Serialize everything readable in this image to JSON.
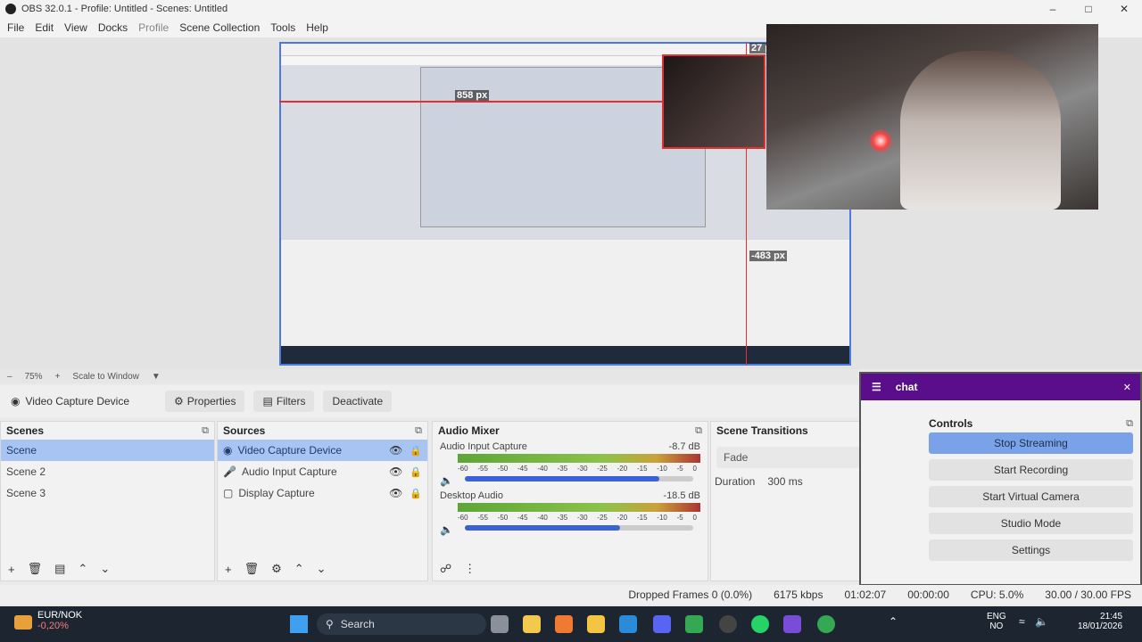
{
  "window": {
    "title": "OBS 32.0.1 - Profile: Untitled - Scenes: Untitled"
  },
  "menu": [
    "File",
    "Edit",
    "View",
    "Docks",
    "Profile",
    "Scene Collection",
    "Tools",
    "Help"
  ],
  "preview": {
    "dim_h_label": "858 px",
    "dim_v_label": "27 px",
    "dim_left_label": "-483 px"
  },
  "zoom": {
    "value": "75%",
    "mode": "Scale to Window"
  },
  "source_toolbar": {
    "source_name": "Video Capture Device",
    "properties": "Properties",
    "filters": "Filters",
    "deactivate": "Deactivate"
  },
  "scenes": {
    "title": "Scenes",
    "items": [
      "Scene",
      "Scene 2",
      "Scene 3"
    ]
  },
  "sources": {
    "title": "Sources",
    "items": [
      "Video Capture Device",
      "Audio Input Capture",
      "Display Capture"
    ]
  },
  "mixer": {
    "title": "Audio Mixer",
    "channels": [
      {
        "name": "Audio Input Capture",
        "db": "-8.7 dB",
        "level": 0.85
      },
      {
        "name": "Desktop Audio",
        "db": "-18.5 dB",
        "level": 0.68
      }
    ],
    "ticks": [
      "-60",
      "-55",
      "-50",
      "-45",
      "-40",
      "-35",
      "-30",
      "-25",
      "-20",
      "-15",
      "-10",
      "-5",
      "0"
    ]
  },
  "transitions": {
    "title": "Scene Transitions",
    "transition": "Fade",
    "duration_label": "Duration",
    "duration": "300 ms"
  },
  "chat": {
    "title": "chat"
  },
  "controls": {
    "title": "Controls",
    "stop_streaming": "Stop Streaming",
    "start_recording": "Start Recording",
    "start_virtual_camera": "Start Virtual Camera",
    "studio_mode": "Studio Mode",
    "settings": "Settings"
  },
  "status": {
    "dropped": "Dropped Frames 0 (0.0%)",
    "kbps": "6175 kbps",
    "stream_time": "01:02:07",
    "rec_time": "00:00:00",
    "cpu": "CPU: 5.0%",
    "fps": "30.00 / 30.00 FPS"
  },
  "taskbar": {
    "ticker_name": "EUR/NOK",
    "ticker_change": "-0,20%",
    "search": "Search",
    "lang1": "ENG",
    "lang2": "NO",
    "time": "21:45",
    "date": "18/01/2026"
  },
  "colors": {
    "accent": "#a7c4f2",
    "chat_bar": "#5b0e8c",
    "selection_red": "#e03030"
  }
}
